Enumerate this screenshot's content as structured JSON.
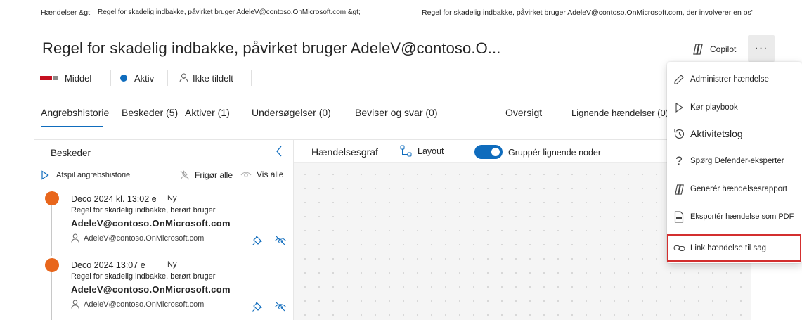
{
  "breadcrumb": {
    "root": "Hændelser &gt;",
    "middle": "Regel for skadelig indbakke, påvirket bruger AdeleV@contoso.OnMicrosoft.com &gt;",
    "current": "Regel for skadelig indbakke, påvirket bruger AdeleV@contoso.OnMicrosoft.com, der involverer en os'"
  },
  "header": {
    "title": "Regel for skadelig indbakke, påvirket bruger AdeleV@contoso.O...",
    "copilot_label": "Copilot",
    "more_label": "···"
  },
  "status": {
    "severity": "Middel",
    "state": "Aktiv",
    "assigned": "Ikke tildelt",
    "severity_colors": [
      "#c50f1f",
      "#c50f1f",
      "#8a8886"
    ],
    "state_color": "#0f6cbd"
  },
  "tabs": [
    {
      "label": "Angrebshistorie",
      "active": true
    },
    {
      "label": "Beskeder (5)"
    },
    {
      "label": "Aktiver (1)"
    },
    {
      "label": "Undersøgelser (0)"
    },
    {
      "label": "Beviser og svar (0)"
    },
    {
      "label": "Oversigt"
    },
    {
      "label": "Lignende hændelser (0)"
    }
  ],
  "left_pane": {
    "title": "Beskeder",
    "play_label": "Afspil angrebshistorie",
    "unpin_label": "Frigør alle",
    "show_label": "Vis alle",
    "alerts": [
      {
        "date": "Deco 2024 kl. 13:02 e",
        "badge": "Ny",
        "description": "Regel for skadelig indbakke, berørt bruger",
        "user_bold": "AdeleV@contoso.OnMicrosoft.com",
        "user": "AdeleV@contoso.OnMicrosoft.com",
        "dot_color": "#e8661c"
      },
      {
        "date": "Deco 2024 13:07 e",
        "badge": "Ny",
        "description": "Regel for skadelig indbakke, berørt bruger",
        "user_bold": "AdeleV@contoso.OnMicrosoft.com",
        "user": "AdeleV@contoso.OnMicrosoft.com",
        "dot_color": "#e8661c"
      }
    ]
  },
  "graph": {
    "title": "Hændelsesgraf",
    "layout_label": "Layout",
    "group_label": "Gruppér lignende noder",
    "group_on": true
  },
  "menu": {
    "items": [
      {
        "label": "Administrer hændelse",
        "icon": "pencil-icon"
      },
      {
        "label": "Kør playbook",
        "icon": "play-icon"
      },
      {
        "label": "Aktivitetslog",
        "icon": "history-icon"
      },
      {
        "label": "Spørg Defender-eksperter",
        "icon": "question-icon"
      },
      {
        "label": "Generér hændelsesrapport",
        "icon": "copilot-icon"
      },
      {
        "label": "Eksportér hændelse som PDF",
        "icon": "pdf-icon"
      },
      {
        "label": "Link hændelse til sag",
        "icon": "link-icon",
        "highlighted": true
      }
    ],
    "highlight_color": "#d32f2f"
  }
}
